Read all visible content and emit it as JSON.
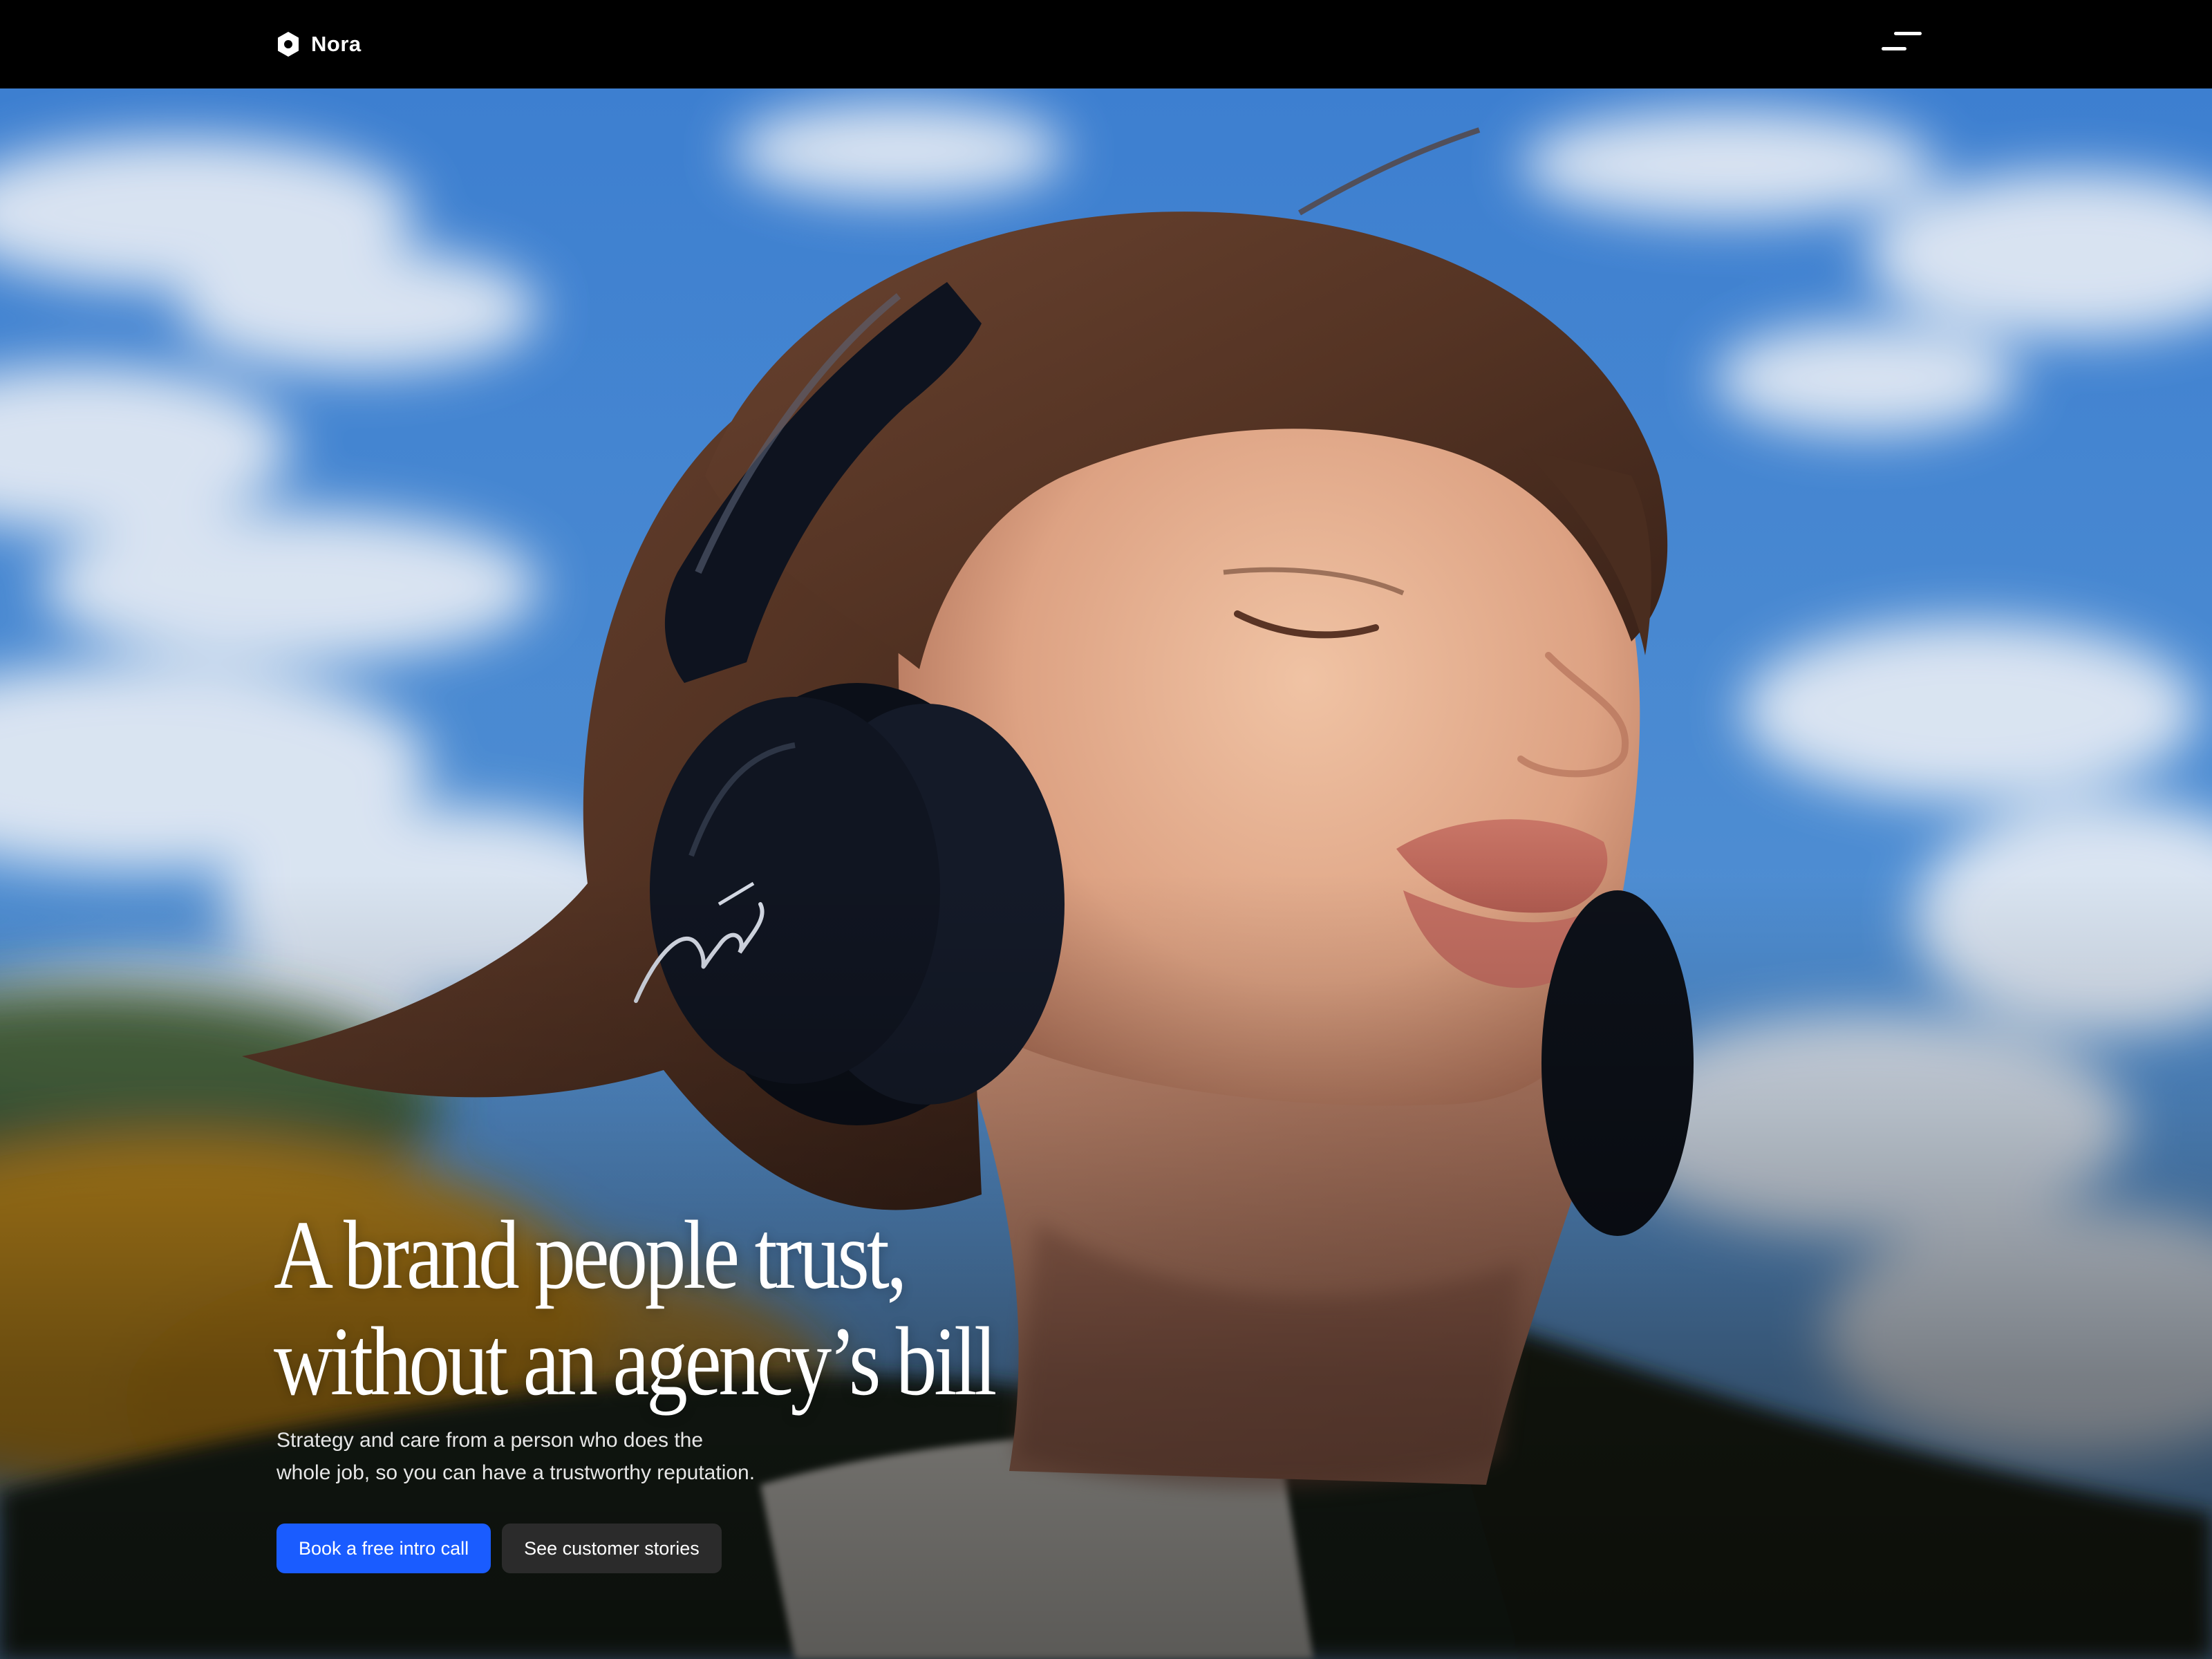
{
  "nav": {
    "brand_name": "Nora",
    "brand_icon": "hexagon-logo-icon",
    "menu_icon": "menu-icon"
  },
  "hero": {
    "image_name": "woman-with-headphones-photo",
    "title_line_1": "A brand people trust,",
    "title_line_2": "without an agency’s bill",
    "subtitle_line_1": "Strategy and care from a person who does the",
    "subtitle_line_2": "whole job, so you can have a trustworthy reputation.",
    "primary_cta": "Book a free intro call",
    "secondary_cta": "See customer stories"
  },
  "colors": {
    "nav_background": "#000000",
    "text": "#ffffff",
    "primary_button": "#1a5cff",
    "secondary_button": "#2b2b2b",
    "sky": "#3f7fc9"
  }
}
